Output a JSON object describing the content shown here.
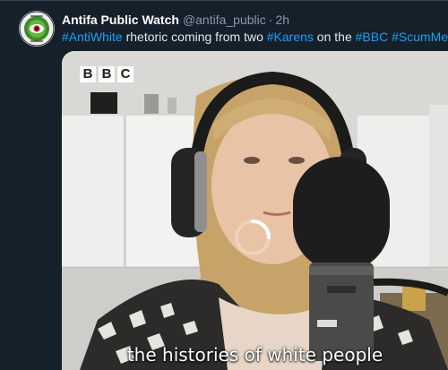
{
  "tweet": {
    "display_name": "Antifa Public Watch",
    "handle": "@antifa_public",
    "separator": "·",
    "time": "2h",
    "text_parts": {
      "t1": "#AntiWhite",
      "t2": " rhetoric coming from two ",
      "t3": "#Karens",
      "t4": " on the ",
      "t5": "#BBC",
      "t6": " ",
      "t7": "#ScumMedia"
    }
  },
  "media": {
    "logo_letters": [
      "B",
      "B",
      "C"
    ],
    "caption": "the histories of white people"
  },
  "colors": {
    "background": "#15202b",
    "link": "#1da1f2",
    "muted": "#8899a6"
  }
}
